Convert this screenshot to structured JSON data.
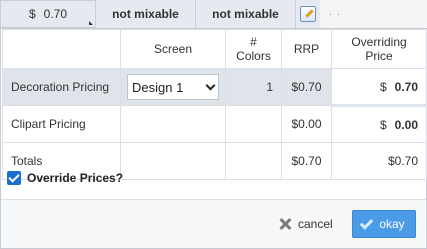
{
  "topbar": {
    "price_currency": "$",
    "price_value": "0.70",
    "col2": "not mixable",
    "col3": "not mixable",
    "dots": "· ·"
  },
  "table": {
    "headers": [
      "",
      "Screen",
      "# Colors",
      "RRP",
      "Overriding Price"
    ],
    "rows": [
      {
        "label": "Decoration Pricing",
        "screen": "Design 1",
        "colors": "1",
        "rrp": "$0.70",
        "override_currency": "$",
        "override_value": "0.70"
      },
      {
        "label": "Clipart Pricing",
        "screen": "",
        "colors": "",
        "rrp": "$0.00",
        "override_currency": "$",
        "override_value": "0.00"
      },
      {
        "label": "Totals",
        "screen": "",
        "colors": "",
        "rrp": "$0.70",
        "override_total": "$0.70"
      }
    ]
  },
  "override": {
    "label": "Override Prices?",
    "checked": true
  },
  "buttons": {
    "cancel": "cancel",
    "ok": "okay"
  },
  "colors": {
    "accent": "#4a9be8",
    "selected_row": "#dfe3ea",
    "checkbox": "#1a6fd1"
  }
}
